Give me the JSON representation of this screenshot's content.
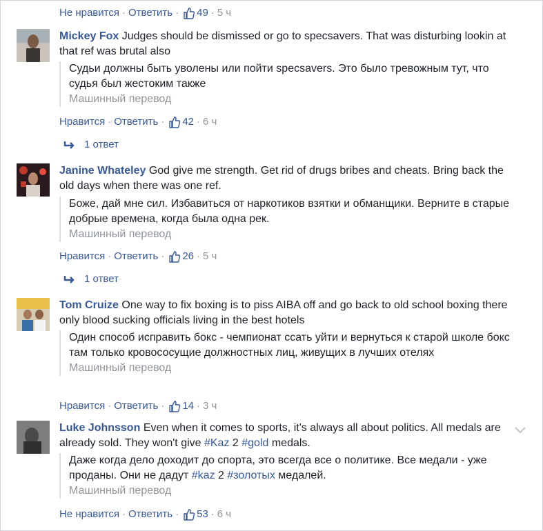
{
  "top_actions": {
    "like": "Не нравится",
    "reply": "Ответить",
    "count": "49",
    "time": "5 ч"
  },
  "comments": [
    {
      "author": "Mickey Fox",
      "text": "Judges should be dismissed or go to specsavers. That was disturbing lookin at that ref was brutal also",
      "translation": "Судьи должны быть уволены или пойти specsavers. Это было тревожным тут, что судья был жестоким также",
      "mt_label": "Машинный перевод",
      "like": "Нравится",
      "reply": "Ответить",
      "count": "42",
      "time": "6 ч",
      "replies": "1 ответ"
    },
    {
      "author": "Janine Whateley",
      "text": "God give me strength. Get rid of drugs bribes and cheats. Bring back the old days when there was one ref.",
      "translation": "Боже, дай мне сил. Избавиться от наркотиков взятки и обманщики. Верните в старые добрые времена, когда была одна рек.",
      "mt_label": "Машинный перевод",
      "like": "Нравится",
      "reply": "Ответить",
      "count": "26",
      "time": "5 ч",
      "replies": "1 ответ"
    },
    {
      "author": "Tom Cruize",
      "text": "One way to fix boxing is to piss AIBA off and go back to old school boxing there only blood sucking officials living in the best hotels",
      "translation": "Один способ исправить бокс - чемпионат ссать уйти и вернуться к старой школе бокс там только кровососущие должностных лиц, живущих в лучших отелях",
      "mt_label": "Машинный перевод",
      "like": "Нравится",
      "reply": "Ответить",
      "count": "14",
      "time": "3 ч"
    },
    {
      "author": "Luke Johnsson",
      "text_a": "Even when it comes to sports, it's always all about politics. All medals are already sold. They won't give ",
      "hash1": "#Kaz",
      "text_b": " 2 ",
      "hash2": "#gold",
      "text_c": " medals.",
      "tr_a": "Даже когда дело доходит до спорта, это всегда все о политике. Все медали - уже проданы. Они не дадут ",
      "tr_hash1": "#kaz",
      "tr_b": " 2 ",
      "tr_hash2": "#золотых",
      "tr_c": " медалей.",
      "mt_label": "Машинный перевод",
      "like": "Не нравится",
      "reply": "Ответить",
      "count": "53",
      "time": "6 ч"
    }
  ],
  "colors": {
    "link": "#365899",
    "meta": "#90949c",
    "text": "#1d2129"
  },
  "icons": [
    "thumbs-up-icon",
    "reply-arrow-icon",
    "chevron-down-icon"
  ]
}
